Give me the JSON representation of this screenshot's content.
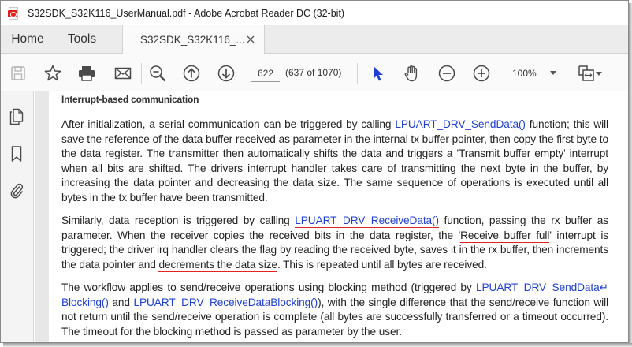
{
  "window": {
    "title": "S32SDK_S32K116_UserManual.pdf - Adobe Acrobat Reader DC (32-bit)"
  },
  "tabs": {
    "home": "Home",
    "tools": "Tools",
    "document": "S32SDK_S32K116_..."
  },
  "toolbar": {
    "page_value": "622",
    "page_count": "(637 of 1070)",
    "zoom": "100%"
  },
  "icons": {
    "save": "save-icon",
    "bookmark": "star-icon",
    "print": "printer-icon",
    "email": "envelope-icon",
    "search": "zoom-search-icon",
    "prev": "arrow-up-circle-icon",
    "next": "arrow-down-circle-icon",
    "select": "pointer-icon",
    "hand": "hand-icon",
    "zoom_out": "minus-circle-icon",
    "zoom_in": "plus-circle-icon",
    "fit": "fit-page-icon",
    "more": "more-icon",
    "pages": "pages-icon",
    "bookmarks": "bookmark-icon",
    "attachments": "paperclip-icon"
  },
  "colors": {
    "accent": "#1f3fd4",
    "annotation": "#e32222",
    "acrobat_red": "#e0201b"
  },
  "document": {
    "heading": "Interrupt-based communication",
    "p1": {
      "a": "After initialization, a serial communication can be triggered by calling ",
      "link": "LPUART_DRV_SendData()",
      "b": " function; this will save the reference of the data buffer received as parameter in the internal tx buffer pointer, then copy the first byte to the data register. The transmitter then automatically shifts the data and triggers a 'Transmit buffer empty' interrupt when all bits are shifted.  The drivers interrupt handler takes care of transmitting the next byte in the buffer, by increasing the data pointer and decreasing the data size.  The same sequence of operations is executed until all bytes in the tx buffer have been transmitted."
    },
    "p2": {
      "a": "Similarly, data reception is triggered by calling ",
      "link": "LPUART_DRV_ReceiveData()",
      "b": " function, passing the rx buffer as parameter.  When the receiver copies the received bits in the data register, the '",
      "hl1": "Receive buffer full",
      "c": "' interrupt is triggered; the driver irq handler clears the flag by reading the received byte, saves it in the rx buffer, then increments the data pointer and ",
      "hl2": "decrements the data size",
      "d": ". This is repeated until all bytes are received."
    },
    "p3": {
      "a": "The workflow applies to send/receive operations using blocking method (triggered by ",
      "link1": "LPUART_DRV_SendData↵ Blocking()",
      "b": " and ",
      "link2": "LPUART_DRV_ReceiveDataBlocking()",
      "c": "), with the single difference that the send/receive function will not return until the send/receive operation is complete (all bytes are successfully transferred or a timeout occurred). The timeout for the blocking method is passed as parameter by the user."
    }
  }
}
